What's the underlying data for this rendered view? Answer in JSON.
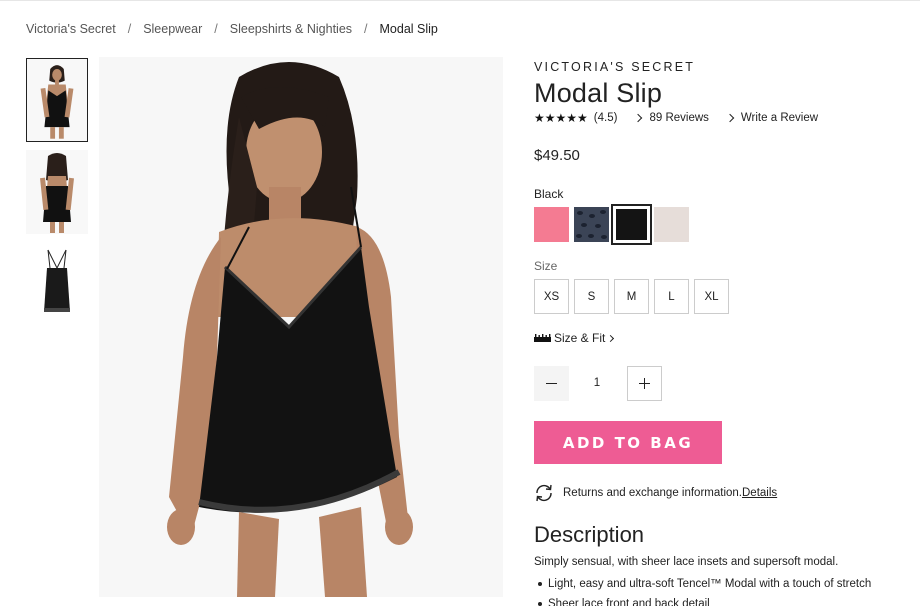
{
  "breadcrumb": {
    "items": [
      "Victoria's Secret",
      "Sleepwear",
      "Sleepshirts & Nighties"
    ],
    "current": "Modal Slip",
    "separator": "/"
  },
  "product": {
    "brand": "VICTORIA'S SECRET",
    "title": "Modal Slip",
    "stars": "★★★★★",
    "rating": "(4.5)",
    "reviews": "89 Reviews",
    "write_review": "Write a Review",
    "price": "$49.50"
  },
  "color": {
    "label": "Black",
    "swatches": [
      {
        "name": "pink",
        "hex": "#f47b92"
      },
      {
        "name": "leopard",
        "hex": "#3b4456"
      },
      {
        "name": "black",
        "hex": "#141414",
        "selected": true
      },
      {
        "name": "blush",
        "hex": "#e6ddd9"
      }
    ]
  },
  "size": {
    "label": "Size",
    "options": [
      "XS",
      "S",
      "M",
      "L",
      "XL"
    ]
  },
  "size_fit": {
    "label": "Size & Fit"
  },
  "quantity": {
    "value": "1"
  },
  "add_to_bag": {
    "label": "ADD TO BAG"
  },
  "returns": {
    "text": "Returns and exchange information.",
    "link": "Details"
  },
  "description": {
    "title": "Description",
    "text": "Simply sensual, with sheer lace insets and supersoft modal.",
    "bullets": [
      "Light, easy and ultra-soft Tencel™ Modal with a touch of stretch",
      "Sheer lace front and back detail"
    ]
  },
  "colors": {
    "accent": "#ee5c94",
    "text": "#222222"
  }
}
